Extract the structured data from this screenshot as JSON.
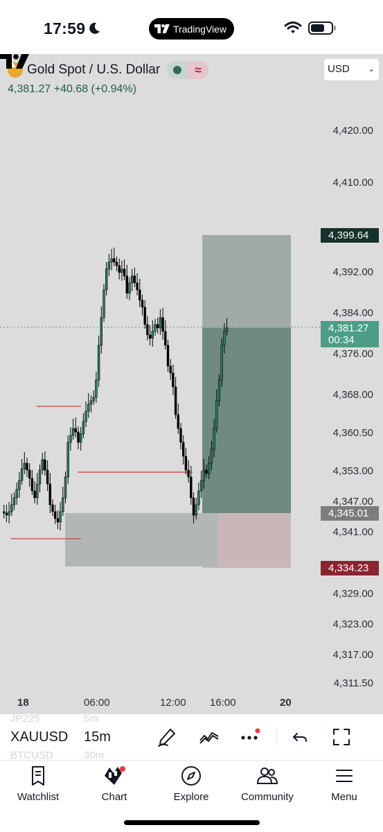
{
  "status_bar": {
    "time": "17:59",
    "app_pill": "TradingView"
  },
  "symbol": {
    "title": "Gold Spot / U.S. Dollar",
    "price_line": "4,381.27  +40.68 (+0.94%)",
    "currency": "USD"
  },
  "colors": {
    "chart_bg": "#dcdcdc",
    "candle_up": "#2e7d66",
    "candle_down": "#000000",
    "profit_zone": "#6f8a80",
    "target_zone": "#a1aaa7",
    "stop_zone": "#c9b6b8",
    "accent_green": "#4c9e86",
    "accent_red": "#8a2430"
  },
  "price_axis": {
    "labels": [
      "4,420.00",
      "4,410.00",
      "4,392.00",
      "4,384.00",
      "4,376.00",
      "4,368.00",
      "4,360.50",
      "4,353.00",
      "4,347.00",
      "4,341.00",
      "4,329.00",
      "4,323.00",
      "4,317.00",
      "4,311.50"
    ],
    "tag_target": "4,399.64",
    "tag_current_price": "4,381.27",
    "tag_current_countdown": "00:34",
    "tag_entry": "4,345.01",
    "tag_stop": "4,334.23"
  },
  "time_axis": {
    "labels": [
      "18",
      "06:00",
      "12:00",
      "16:00",
      "20"
    ]
  },
  "chart_data": {
    "type": "candlestick",
    "symbol": "XAUUSD",
    "interval": "15m",
    "ylim": [
      4311.5,
      4420
    ],
    "position": {
      "target": 4399.64,
      "entry": 4345.01,
      "stop": 4334.23
    },
    "last_price": 4381.27
  },
  "toolbar": {
    "symbol": "XAUUSD",
    "interval": "15m",
    "ghost_symbol_above": "JP225",
    "ghost_interval_above": "5m",
    "ghost_symbol_below": "BTCUSD",
    "ghost_interval_below": "30m",
    "icons": [
      "pen-icon",
      "indicators-icon",
      "more-icon",
      "undo-icon",
      "fullscreen-icon"
    ]
  },
  "tabs": [
    {
      "label": "Watchlist",
      "icon": "bookmark-icon"
    },
    {
      "label": "Chart",
      "icon": "candles-icon"
    },
    {
      "label": "Explore",
      "icon": "compass-icon"
    },
    {
      "label": "Community",
      "icon": "people-icon"
    },
    {
      "label": "Menu",
      "icon": "hamburger-icon"
    }
  ]
}
